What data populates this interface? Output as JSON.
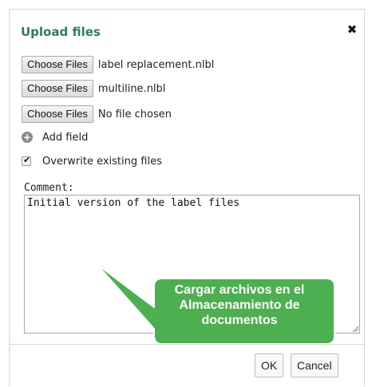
{
  "dialog": {
    "title": "Upload files",
    "close_symbol": "✖"
  },
  "files": [
    {
      "button_label": "Choose Files",
      "file_name": "label replacement.nlbl"
    },
    {
      "button_label": "Choose Files",
      "file_name": "multiline.nlbl"
    },
    {
      "button_label": "Choose Files",
      "file_name": "No file chosen"
    }
  ],
  "add_field": {
    "icon": "plus-circle-icon",
    "label": "Add field"
  },
  "overwrite": {
    "checked": true,
    "label": "Overwrite existing files"
  },
  "comment": {
    "label": "Comment:",
    "value": "Initial version of the label files"
  },
  "callout": {
    "text": "Cargar archivos en el Almacenamiento de documentos",
    "fill_color": "#4caf50",
    "border_color": "#ffffff"
  },
  "footer": {
    "ok_label": "OK",
    "cancel_label": "Cancel"
  },
  "colors": {
    "title": "#2e7d5b"
  }
}
